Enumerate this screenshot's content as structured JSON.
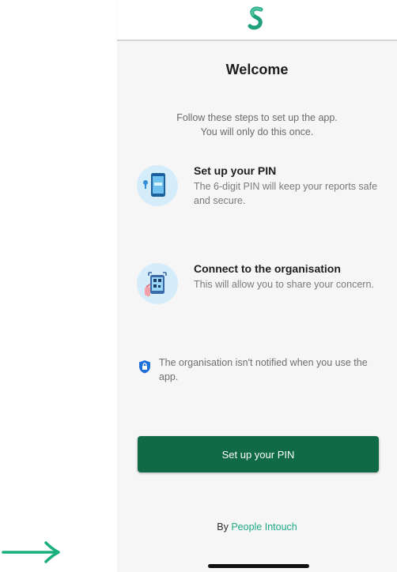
{
  "app": {
    "logo_icon": "s-logo-icon",
    "brand_color": "#20a985",
    "primary_color": "#0f6a45"
  },
  "welcome": {
    "title": "Welcome",
    "intro_line1": "Follow these steps to set up the app.",
    "intro_line2": "You will only do this once."
  },
  "steps": [
    {
      "icon": "phone-pin-icon",
      "title": "Set up your PIN",
      "description": "The 6-digit PIN will keep your reports safe and secure."
    },
    {
      "icon": "qr-scan-icon",
      "title": "Connect to the organisation",
      "description": "This will allow you to share your concern."
    }
  ],
  "notice": {
    "icon": "shield-lock-icon",
    "text": "The organisation isn't notified when you use the app."
  },
  "cta": {
    "label": "Set up your PIN"
  },
  "footer": {
    "prefix": "By",
    "brand": "People Intouch"
  },
  "annotation": {
    "icon": "right-arrow-icon",
    "color": "#19b07e"
  }
}
